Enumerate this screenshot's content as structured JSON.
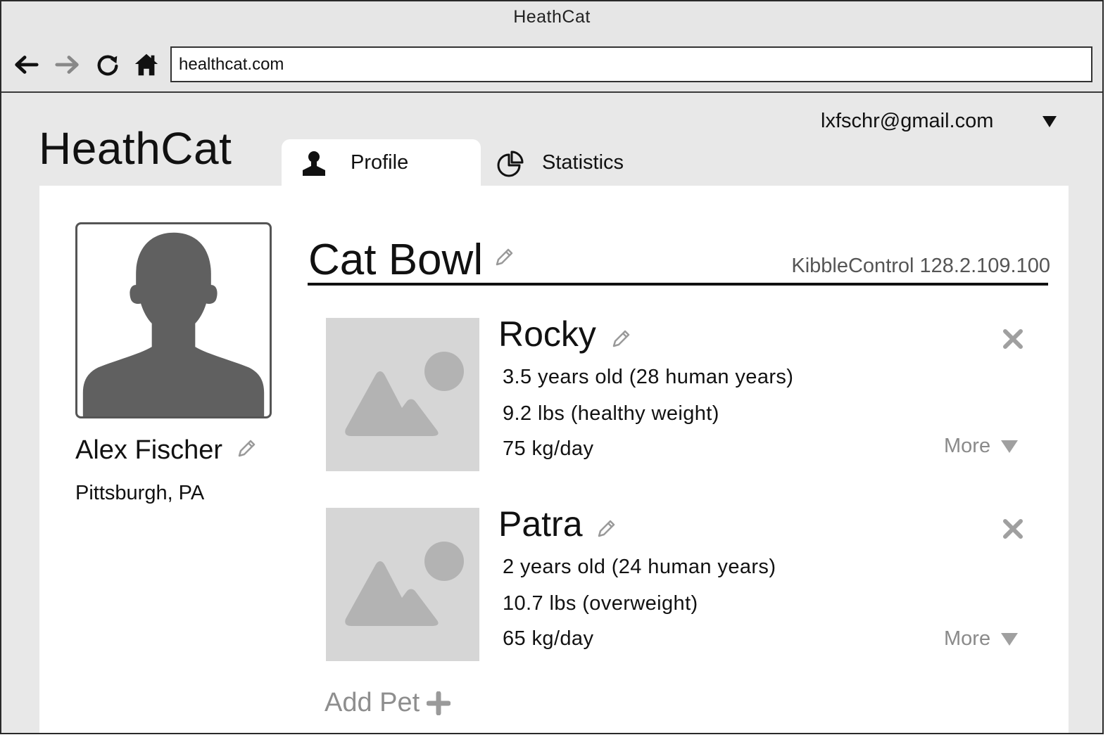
{
  "browser": {
    "window_title": "HeathCat",
    "url": "healthcat.com"
  },
  "app": {
    "brand": "HeathCat",
    "user_email": "lxfschr@gmail.com",
    "tabs": [
      {
        "label": "Profile",
        "icon": "user-icon",
        "active": true
      },
      {
        "label": "Statistics",
        "icon": "pie-chart-icon",
        "active": false
      }
    ]
  },
  "profile": {
    "name": "Alex Fischer",
    "location": "Pittsburgh, PA"
  },
  "bowl": {
    "title": "Cat Bowl",
    "device": "KibbleControl 128.2.109.100"
  },
  "pets": [
    {
      "name": "Rocky",
      "age": "3.5 years old (28 human years)",
      "weight": "9.2 lbs (healthy weight)",
      "food": "75 kg/day",
      "more_label": "More"
    },
    {
      "name": "Patra",
      "age": "2 years old (24 human years)",
      "weight": "10.7 lbs (overweight)",
      "food": "65 kg/day",
      "more_label": "More"
    }
  ],
  "add_pet_label": "Add Pet",
  "colors": {
    "window_bg": "#e8e8e8",
    "panel_bg": "#ffffff",
    "placeholder": "#d6d6d6",
    "muted_text": "#8a8a8a",
    "avatar_fill": "#606060"
  }
}
